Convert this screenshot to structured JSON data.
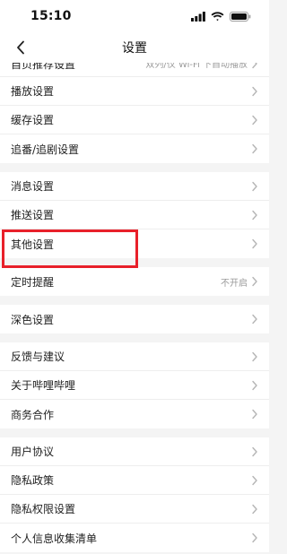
{
  "status_bar": {
    "time": "15:10"
  },
  "header": {
    "title": "设置"
  },
  "groups": [
    {
      "items": [
        {
          "label": "自页推荐设置",
          "value": "双列/仅 Wi-Fi 下自动播放"
        },
        {
          "label": "播放设置",
          "value": ""
        },
        {
          "label": "缓存设置",
          "value": ""
        },
        {
          "label": "追番/追剧设置",
          "value": ""
        }
      ]
    },
    {
      "items": [
        {
          "label": "消息设置",
          "value": ""
        },
        {
          "label": "推送设置",
          "value": ""
        },
        {
          "label": "其他设置",
          "value": ""
        }
      ]
    },
    {
      "items": [
        {
          "label": "定时提醒",
          "value": "不开启"
        }
      ]
    },
    {
      "items": [
        {
          "label": "深色设置",
          "value": ""
        }
      ]
    },
    {
      "items": [
        {
          "label": "反馈与建议",
          "value": ""
        },
        {
          "label": "关于哔哩哔哩",
          "value": ""
        },
        {
          "label": "商务合作",
          "value": ""
        }
      ]
    },
    {
      "items": [
        {
          "label": "用户协议",
          "value": ""
        },
        {
          "label": "隐私政策",
          "value": ""
        },
        {
          "label": "隐私权限设置",
          "value": ""
        },
        {
          "label": "个人信息收集清单",
          "value": ""
        }
      ]
    }
  ],
  "icons": {
    "back": "chevron-left-icon",
    "row_arrow": "chevron-right-icon",
    "signal": "signal-bars-icon",
    "wifi": "wifi-icon",
    "battery": "battery-icon"
  },
  "colors": {
    "highlight_box": "#e8202a",
    "background": "#f4f4f4",
    "secondary_text": "#9a9a9a"
  }
}
